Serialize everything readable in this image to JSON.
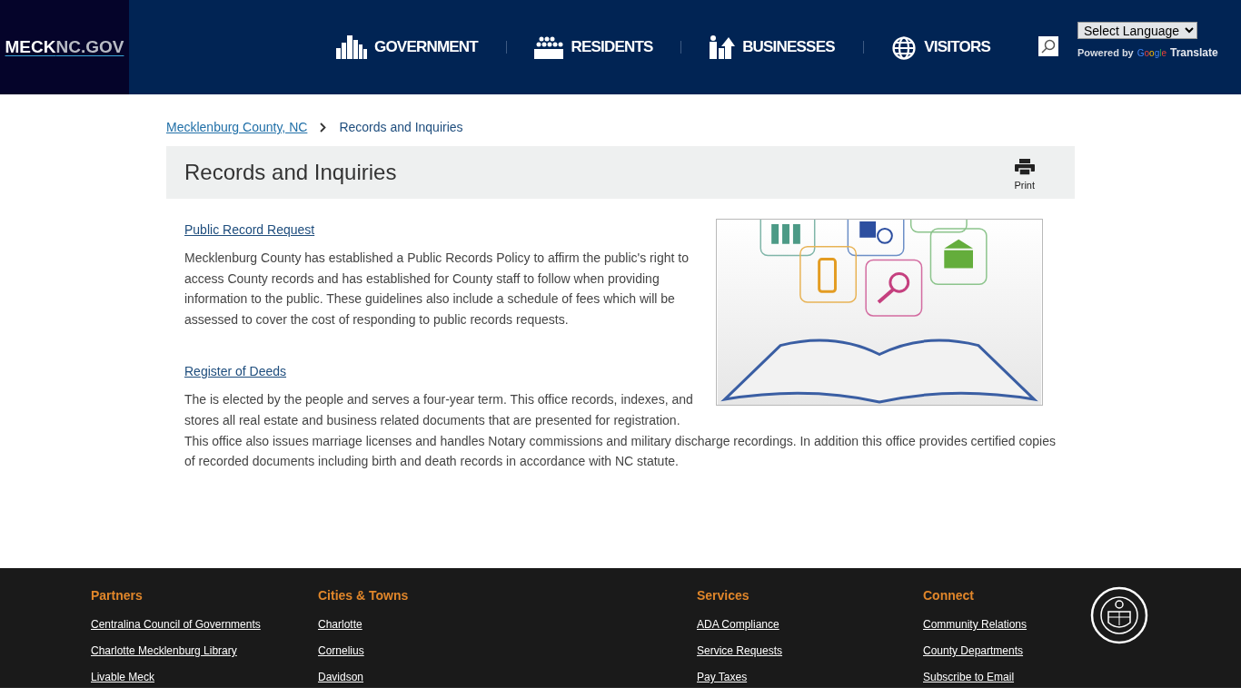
{
  "header": {
    "logo": "**MECK**NC.GOV",
    "nav": [
      {
        "label": "GOVERNMENT"
      },
      {
        "label": "RESIDENTS"
      },
      {
        "label": "BUSINESSES"
      },
      {
        "label": "VISITORS"
      }
    ],
    "language_select": {
      "value": "Select Language"
    },
    "powered_by": "Powered by",
    "google": "Google",
    "translate": "Translate"
  },
  "breadcrumb": [
    {
      "label": "Mecklenburg County, NC",
      "link": true
    },
    {
      "label": "Records and Inquiries",
      "link": false
    }
  ],
  "page_title": "Records and Inquiries",
  "print": "Print",
  "sections": [
    {
      "title": "Public Record Request",
      "body": "Mecklenburg County has established a Public Records Policy to affirm the public's right to access County records and has established for County staff to follow when providing information to the public. These guidelines also include a schedule of fees which will be assessed to cover the cost of responding to public records requests."
    },
    {
      "title": "Register of Deeds",
      "body": "The is elected by the people and serves a four-year term. This office records, indexes, and stores all real estate and business related documents that are presented for registration. This office also issues marriage licenses and handles Notary commissions and military discharge recordings. In addition this office provides certified copies of recorded documents including birth and death records in accordance with NC statute."
    }
  ],
  "footer": {
    "columns": [
      {
        "heading": "Partners",
        "links": [
          "Centralina Council of Governments",
          "Charlotte Mecklenburg Library",
          "Livable Meck"
        ]
      },
      {
        "heading": "Cities & Towns",
        "links": [
          "Charlotte",
          "Cornelius",
          "Davidson"
        ]
      },
      {
        "heading": "Services",
        "links": [
          "ADA Compliance",
          "Service Requests",
          "Pay Taxes"
        ]
      },
      {
        "heading": "Connect",
        "links": [
          "Community Relations",
          "County Departments",
          "Subscribe to Email"
        ]
      }
    ]
  }
}
